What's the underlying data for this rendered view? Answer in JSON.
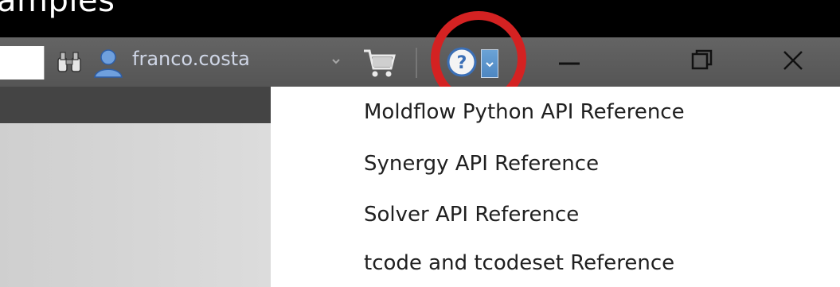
{
  "slide_caption": "amples",
  "titlebar": {
    "username": "franco.costa",
    "icons": [
      "binoculars-icon",
      "user-icon",
      "chevron-down-icon",
      "cart-icon",
      "help-icon",
      "chevron-down-icon",
      "minimize-icon",
      "restore-icon",
      "close-icon"
    ]
  },
  "help_menu": {
    "items": [
      "Moldflow Python API Reference",
      "Synergy API Reference",
      "Solver API Reference",
      "tcode and tcodeset Reference"
    ]
  },
  "colors": {
    "highlight_ring": "#d42222",
    "help_dropdown_button": "#5b93cc",
    "titlebar": "#5c5c5c"
  }
}
